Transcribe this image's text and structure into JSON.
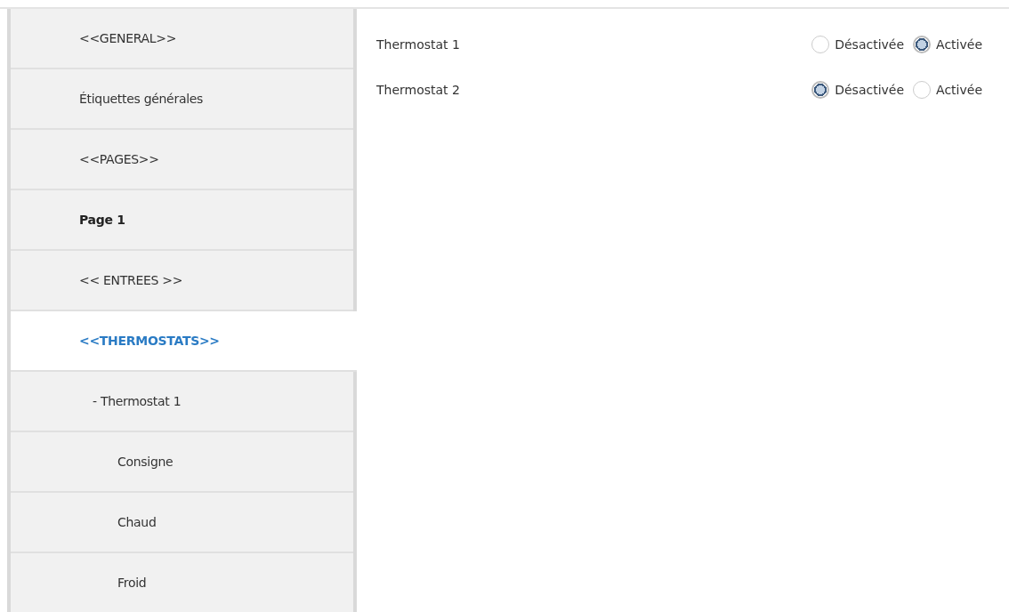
{
  "sidebar": {
    "items": [
      {
        "label": "<<GENERAL>>",
        "selected": false,
        "bold": false
      },
      {
        "label": "Étiquettes générales",
        "selected": false,
        "bold": false
      },
      {
        "label": "<<PAGES>>",
        "selected": false,
        "bold": false
      },
      {
        "label": "Page 1",
        "selected": false,
        "bold": true
      },
      {
        "label": "<< ENTREES >>",
        "selected": false,
        "bold": false
      },
      {
        "label": "<<THERMOSTATS>>",
        "selected": true,
        "bold": false,
        "children": [
          {
            "label": "- Thermostat 1",
            "selected": false,
            "bold": false,
            "children": [
              {
                "label": "Consigne",
                "selected": false,
                "bold": false
              },
              {
                "label": "Chaud",
                "selected": false,
                "bold": false
              },
              {
                "label": "Froid",
                "selected": false,
                "bold": false
              }
            ]
          }
        ]
      }
    ]
  },
  "settings": [
    {
      "label": "Thermostat 1",
      "options": [
        {
          "label": "Désactivée",
          "selected": false
        },
        {
          "label": "Activée",
          "selected": true
        }
      ]
    },
    {
      "label": "Thermostat 2",
      "options": [
        {
          "label": "Désactivée",
          "selected": true
        },
        {
          "label": "Activée",
          "selected": false
        }
      ]
    }
  ]
}
